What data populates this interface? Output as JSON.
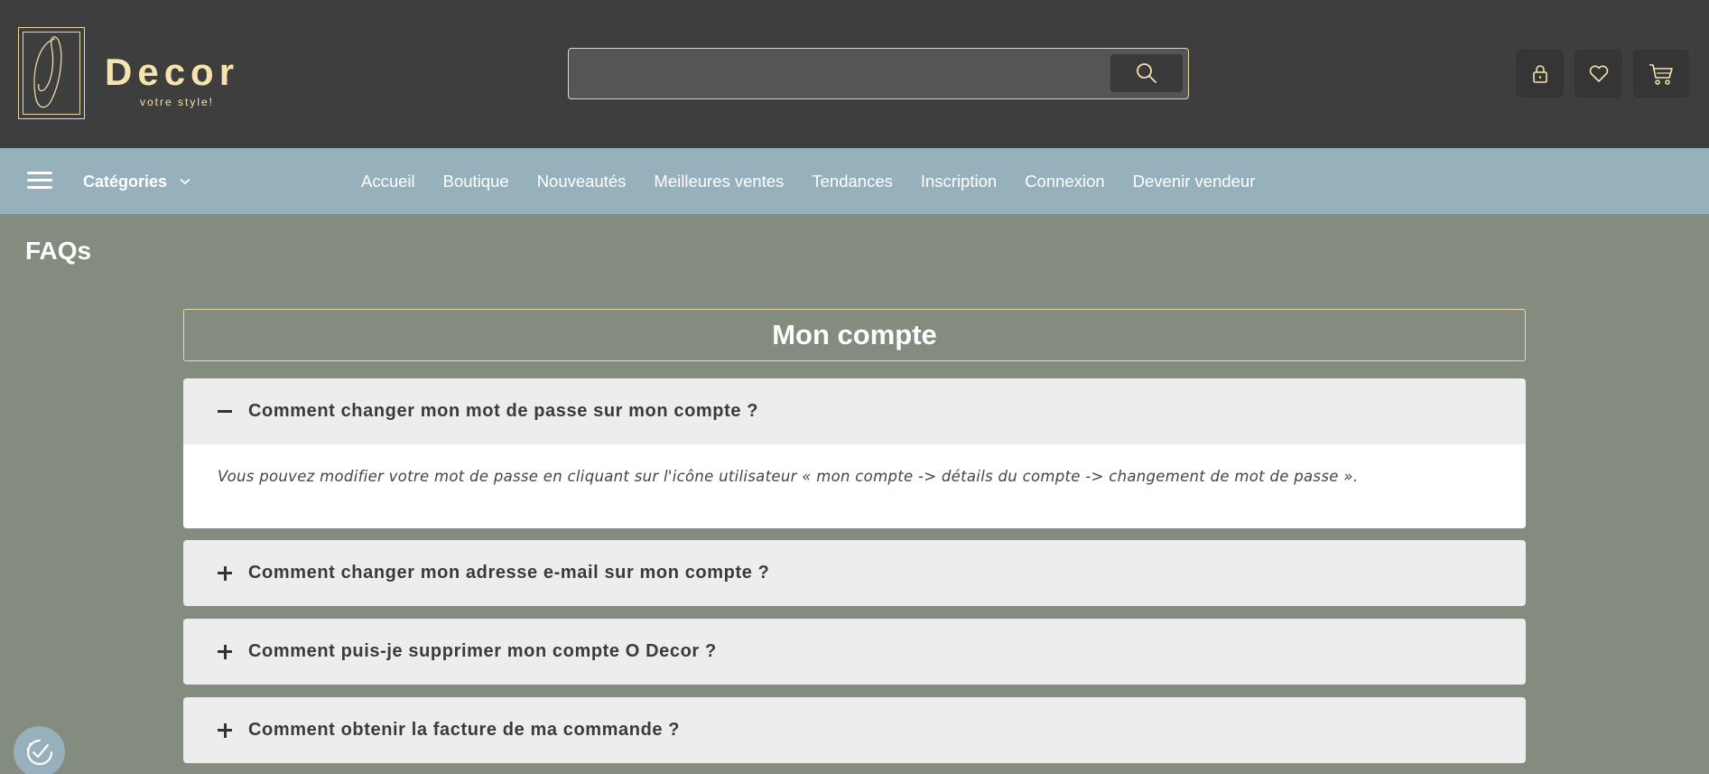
{
  "header": {
    "brand_name": "Decor",
    "brand_tagline": "votre style!",
    "search": {
      "value": "",
      "placeholder": ""
    },
    "icons": [
      "lock-icon",
      "heart-icon",
      "cart-icon"
    ]
  },
  "nav": {
    "categories_label": "Catégories",
    "links": [
      "Accueil",
      "Boutique",
      "Nouveautés",
      "Meilleures ventes",
      "Tendances",
      "Inscription",
      "Connexion",
      "Devenir vendeur"
    ]
  },
  "main": {
    "page_title": "FAQs",
    "section_title": "Mon compte",
    "faqs": [
      {
        "question": "Comment changer mon mot de passe sur mon compte ?",
        "answer": "Vous pouvez modifier votre mot de passe en cliquant sur l'icône utilisateur « mon compte -> détails du compte -> changement de mot de passe ».",
        "expanded": true
      },
      {
        "question": "Comment changer mon adresse e-mail sur mon compte ?",
        "expanded": false
      },
      {
        "question": "Comment puis-je supprimer mon compte O Decor ?",
        "expanded": false
      },
      {
        "question": "Comment obtenir la facture de ma commande ?",
        "expanded": false
      }
    ]
  },
  "colors": {
    "header_bg": "#3e3e3e",
    "nav_bg": "#96b1bb",
    "page_bg": "#838c7e",
    "accent_gold": "#f6e3ad"
  }
}
